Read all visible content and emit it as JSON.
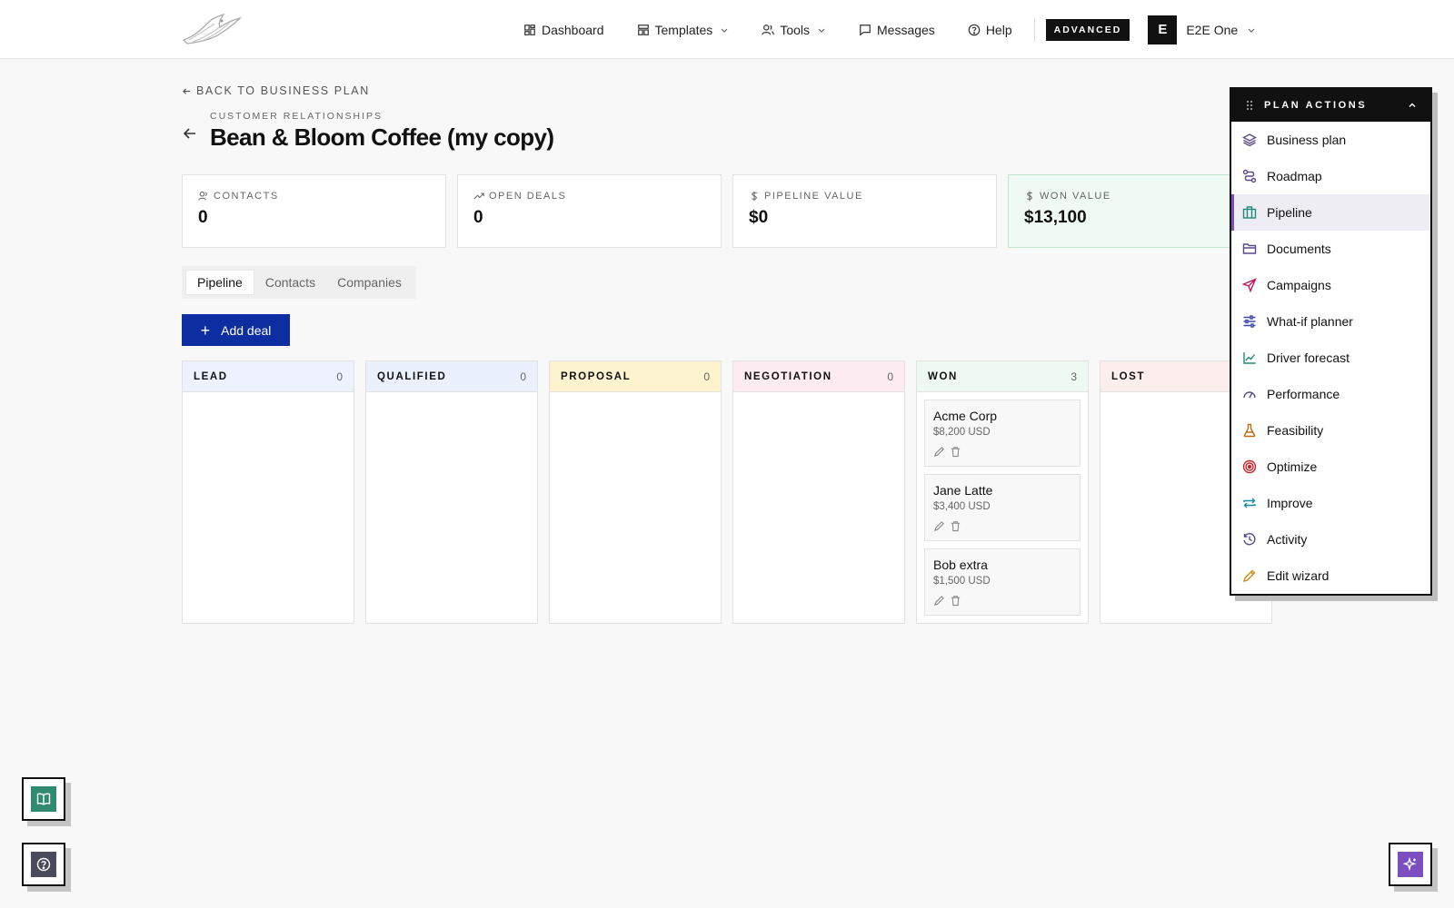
{
  "nav": {
    "links": [
      {
        "label": "Dashboard",
        "icon": "dashboard-icon"
      },
      {
        "label": "Templates",
        "icon": "templates-icon"
      },
      {
        "label": "Tools",
        "icon": "users-icon"
      },
      {
        "label": "Messages",
        "icon": "message-icon"
      },
      {
        "label": "Help",
        "icon": "help-icon"
      }
    ],
    "badge": "ADVANCED",
    "user": {
      "initial": "E",
      "name": "E2E One"
    }
  },
  "header": {
    "back_label": "BACK TO BUSINESS PLAN",
    "eyebrow": "CUSTOMER RELATIONSHIPS",
    "title": "Bean & Bloom Coffee (my copy)"
  },
  "stats": [
    {
      "label": "CONTACTS",
      "value": "0",
      "icon": "users-icon"
    },
    {
      "label": "OPEN DEALS",
      "value": "0",
      "icon": "trend-up-icon"
    },
    {
      "label": "PIPELINE VALUE",
      "value": "$0",
      "icon": "dollar-icon"
    },
    {
      "label": "WON VALUE",
      "value": "$13,100",
      "icon": "dollar-icon"
    }
  ],
  "tabs": [
    "Pipeline",
    "Contacts",
    "Companies"
  ],
  "add_deal_label": "Add deal",
  "columns": [
    {
      "label": "LEAD",
      "count": "0"
    },
    {
      "label": "QUALIFIED",
      "count": "0"
    },
    {
      "label": "PROPOSAL",
      "count": "0"
    },
    {
      "label": "NEGOTIATION",
      "count": "0"
    },
    {
      "label": "WON",
      "count": "3"
    },
    {
      "label": "LOST",
      "count": ""
    }
  ],
  "won_cards": [
    {
      "name": "Acme Corp",
      "amount": "$8,200 USD"
    },
    {
      "name": "Jane Latte",
      "amount": "$3,400 USD"
    },
    {
      "name": "Bob extra",
      "amount": "$1,500 USD"
    }
  ],
  "plan_actions": {
    "title": "PLAN ACTIONS",
    "items": [
      {
        "label": "Business plan",
        "icon": "layers-icon",
        "color": "#5b4a8a"
      },
      {
        "label": "Roadmap",
        "icon": "roadmap-icon",
        "color": "#5b4a8a"
      },
      {
        "label": "Pipeline",
        "icon": "briefcase-icon",
        "color": "#1f8a7a"
      },
      {
        "label": "Documents",
        "icon": "folder-icon",
        "color": "#5b4a8a"
      },
      {
        "label": "Campaigns",
        "icon": "send-icon",
        "color": "#c2185b"
      },
      {
        "label": "What-if planner",
        "icon": "sliders-icon",
        "color": "#3949ab"
      },
      {
        "label": "Driver forecast",
        "icon": "chart-line-icon",
        "color": "#1f8a7a"
      },
      {
        "label": "Performance",
        "icon": "gauge-icon",
        "color": "#5b4a8a"
      },
      {
        "label": "Feasibility",
        "icon": "flask-icon",
        "color": "#b86b12"
      },
      {
        "label": "Optimize",
        "icon": "target-icon",
        "color": "#c62828"
      },
      {
        "label": "Improve",
        "icon": "repeat-icon",
        "color": "#1e88a8"
      },
      {
        "label": "Activity",
        "icon": "history-icon",
        "color": "#5b4a8a"
      },
      {
        "label": "Edit wizard",
        "icon": "pencil-icon",
        "color": "#d18a12"
      }
    ]
  },
  "colors": {
    "accent": "#0d2ea0",
    "won_bg": "#eefaf3",
    "guide_btn": "#2e8b6e",
    "help_btn": "#4a4a5e",
    "ai_btn": "#7b4fc0"
  }
}
